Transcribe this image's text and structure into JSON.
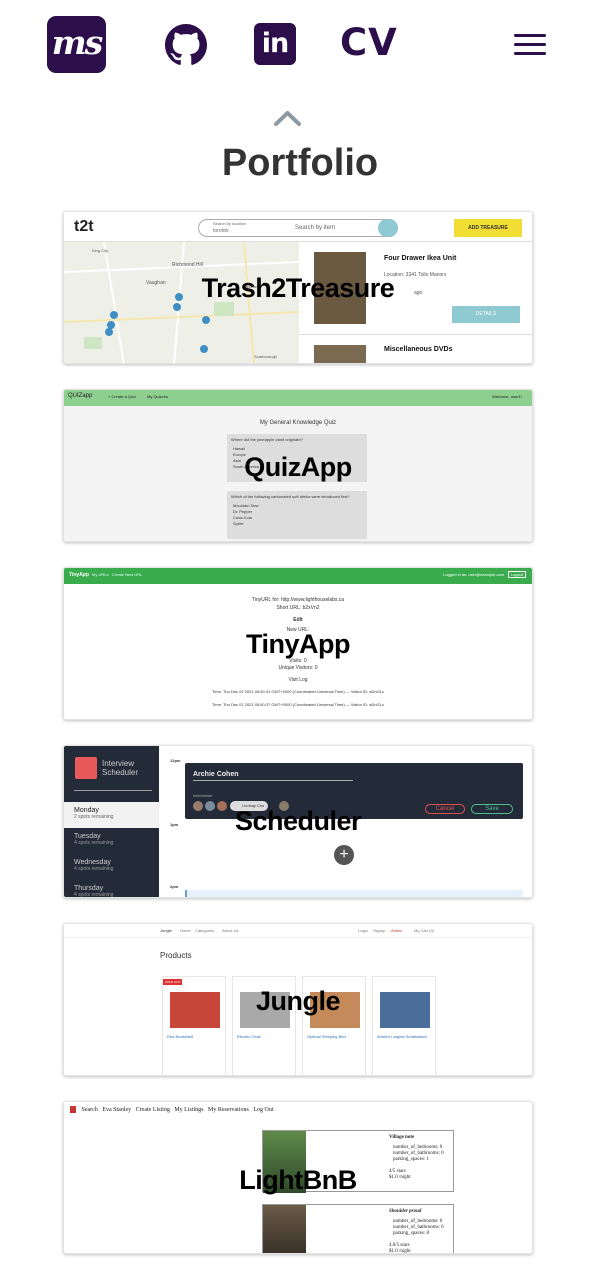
{
  "nav": {
    "logo_text": "ms",
    "github_icon": "github-icon",
    "linkedin_text": "in",
    "cv_label": "CV",
    "menu_icon": "hamburger-menu-icon",
    "brand_color": "#2b0e4a"
  },
  "scroll_up_icon": "chevron-up-icon",
  "page_title": "Portfolio",
  "projects": [
    {
      "name": "Trash2Treasure",
      "screenshot": {
        "logo": "t2t",
        "search_location_label": "Search by location",
        "search_location_value": "toronto",
        "search_item_placeholder": "Search by item",
        "add_button": "ADD TREASURE",
        "item_title": "Four Drawer Ikea Unit",
        "item_location": "Location: 3341 Tollo Manors",
        "item_time": "ago",
        "detail_button": "DETAILS",
        "item2_title": "Miscellaneous DVDs",
        "map_labels": [
          "King City",
          "Richmond Hill",
          "Vaughan",
          "Markham",
          "Scarborough"
        ]
      }
    },
    {
      "name": "QuizApp",
      "screenshot": {
        "brand": "QUIZapp",
        "menu": [
          "+ Create a Quiz",
          "My Quizzes"
        ],
        "welcome": "Welcome, user1!",
        "quiz_title": "My General Knowledge Quiz",
        "q1": "Where did the pineapple plant originate?",
        "q1_options": [
          "Hawaii",
          "Europe",
          "Asia",
          "South America"
        ],
        "q2": "Which of the following carbonated soft drinks were introduced first?",
        "q2_options": [
          "Mountain Dew",
          "Dr. Pepper",
          "Coca-Cola",
          "Sprite"
        ]
      }
    },
    {
      "name": "TinyApp",
      "screenshot": {
        "brand": "TinyApp",
        "menu": [
          "My URLs",
          "Create New URL"
        ],
        "logged_in": "Logged in as: user@example.com",
        "logout": "Logout",
        "long_url": "TinyURL for: http://www.lighthouselabs.ca",
        "short_url": "Short URL: b2xVn2",
        "edit": "Edit",
        "new_url": "New URL:",
        "visits": "Visits: 0",
        "unique": "Unique Visitors: 0",
        "visit_log": "Visit Log",
        "time1": "Time: Thu Dec 02 2021 05:50:31 GMT+0000 (Coordinated Universal Time) — Visitor ID: aDnGLc",
        "time2": "Time: Thu Dec 02 2021 05:50:37 GMT+0000 (Coordinated Universal Time) — Visitor ID: aDnGLc"
      }
    },
    {
      "name": "Scheduler",
      "screenshot": {
        "app_title": "Interview Scheduler",
        "days": [
          {
            "day": "Monday",
            "spots": "2 spots remaining"
          },
          {
            "day": "Tuesday",
            "spots": "4 spots remaining"
          },
          {
            "day": "Wednesday",
            "spots": "4 spots remaining"
          },
          {
            "day": "Thursday",
            "spots": "4 spots remaining"
          }
        ],
        "times": [
          "12pm",
          "1pm",
          "2pm"
        ],
        "student": "Archie Cohen",
        "interviewer_label": "Interviewer",
        "interviewer_name": "Lindsay Chu",
        "cancel": "Cancel",
        "save": "Save"
      }
    },
    {
      "name": "Jungle",
      "screenshot": {
        "brand": "Jungle",
        "menu": [
          "Home",
          "Categories",
          "About Us"
        ],
        "right_menu": [
          "Login",
          "Signup",
          "Admin",
          "My Cart (0)"
        ],
        "heading": "Products",
        "items": [
          {
            "title": "Red Bookshelf",
            "badge": "SOLD OUT"
          },
          {
            "title": "Electric Chair",
            "badge": ""
          },
          {
            "title": "Optimal Sleeping Bed",
            "badge": ""
          },
          {
            "title": "World's Largest Smartwatch",
            "badge": ""
          }
        ]
      }
    },
    {
      "name": "LightBnB",
      "screenshot": {
        "menu": [
          "Search",
          "Eva Stanley",
          "Create Listing",
          "My Listings",
          "My Reservations",
          "Log Out"
        ],
        "listing1_title": "Village note",
        "listing2_title": "Shoulder proud",
        "listing_specs": [
          "number_of_bedrooms: 0",
          "number_of_bathrooms: 0",
          "parking_spaces: 1"
        ],
        "listing1_rating": "4/5 stars",
        "listing1_price": "$1.0 /night",
        "listing2_specs": [
          "number_of_bedrooms: 6",
          "number_of_bathrooms: 6",
          "parking_spaces: 8"
        ],
        "listing2_rating": "4.0/5 stars",
        "listing2_price": "$1.0 /night"
      }
    }
  ]
}
